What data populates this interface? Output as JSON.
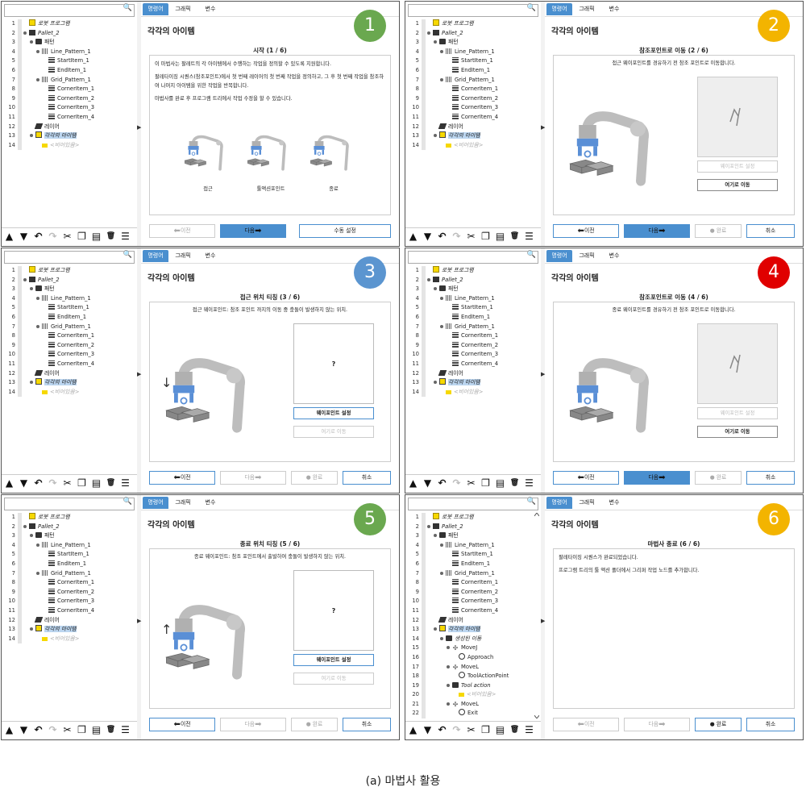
{
  "tree": {
    "base": [
      {
        "n": "1",
        "label": "로봇 프로그램",
        "icon": "prog",
        "indent": 0,
        "italic": true,
        "pin": false
      },
      {
        "n": "2",
        "label": "Pallet_2",
        "icon": "pal",
        "indent": 0,
        "italic": true,
        "pin": true
      },
      {
        "n": "3",
        "label": "패턴",
        "icon": "fold",
        "indent": 1,
        "italic": false,
        "pin": true
      },
      {
        "n": "4",
        "label": "Line_Pattern_1",
        "icon": "grid",
        "indent": 2,
        "italic": false,
        "pin": true
      },
      {
        "n": "5",
        "label": "StartItem_1",
        "icon": "item",
        "indent": 3,
        "italic": false,
        "pin": false
      },
      {
        "n": "6",
        "label": "EndItem_1",
        "icon": "item",
        "indent": 3,
        "italic": false,
        "pin": false
      },
      {
        "n": "7",
        "label": "Grid_Pattern_1",
        "icon": "grid",
        "indent": 2,
        "italic": false,
        "pin": true
      },
      {
        "n": "8",
        "label": "CornerItem_1",
        "icon": "item",
        "indent": 3,
        "italic": false,
        "pin": false
      },
      {
        "n": "9",
        "label": "CornerItem_2",
        "icon": "item",
        "indent": 3,
        "italic": false,
        "pin": false
      },
      {
        "n": "10",
        "label": "CornerItem_3",
        "icon": "item",
        "indent": 3,
        "italic": false,
        "pin": false
      },
      {
        "n": "11",
        "label": "CornerItem_4",
        "icon": "item",
        "indent": 3,
        "italic": false,
        "pin": false
      },
      {
        "n": "12",
        "label": "레이어",
        "icon": "layer",
        "indent": 1,
        "italic": false,
        "pin": false
      },
      {
        "n": "13",
        "label": "각각의 아이템",
        "icon": "each",
        "indent": 1,
        "italic": true,
        "pin": true,
        "sel": true
      },
      {
        "n": "14",
        "label": "<비어있음>",
        "icon": "ph",
        "indent": 2,
        "italic": true,
        "pin": false,
        "gray": true
      }
    ],
    "final_tail": [
      {
        "n": "14",
        "label": "생성된 이동",
        "icon": "fold",
        "indent": 2,
        "italic": true,
        "pin": true
      },
      {
        "n": "15",
        "label": "MoveJ",
        "icon": "mv",
        "indent": 3,
        "italic": false,
        "pin": true
      },
      {
        "n": "16",
        "label": "Approach",
        "icon": "ring",
        "indent": 4,
        "italic": false,
        "pin": false
      },
      {
        "n": "17",
        "label": "MoveL",
        "icon": "mv",
        "indent": 3,
        "italic": false,
        "pin": true
      },
      {
        "n": "18",
        "label": "ToolActionPoint",
        "icon": "ring",
        "indent": 4,
        "italic": false,
        "pin": false
      },
      {
        "n": "19",
        "label": "Tool action",
        "icon": "fold",
        "indent": 3,
        "italic": true,
        "pin": true
      },
      {
        "n": "20",
        "label": "<비어있음>",
        "icon": "ph",
        "indent": 4,
        "italic": true,
        "pin": false,
        "gray": true
      },
      {
        "n": "21",
        "label": "MoveL",
        "icon": "mv",
        "indent": 3,
        "italic": false,
        "pin": true
      },
      {
        "n": "22",
        "label": "Exit",
        "icon": "ring",
        "indent": 4,
        "italic": false,
        "pin": false
      }
    ]
  },
  "tabs": [
    "명령어",
    "그래픽",
    "변수"
  ],
  "page_title": "각각의 아이템",
  "buttons": {
    "prev": "이전",
    "next": "다음",
    "finish": "완료",
    "cancel": "취소",
    "manual": "수동 설정",
    "set_waypoint": "웨이포인트 설정",
    "move_here": "여기로 이동"
  },
  "panels": [
    {
      "badge": "1",
      "badge_color": "#6aa84f",
      "step": "시작 (1 / 6)",
      "texts": [
        "이 마법사는 팔레트의 각 아이템에서 수행하는 작업을 정의할 수 있도록 지원합니다.",
        "팔레타이징 시퀀스(참조포인트)에서 첫 번째 레이어의 첫 번째 작업을 정의하고, 그 후 첫 번째 작업을 참조하여 나머지 아이템을 위한 작업을 반복합니다.",
        "마법사를 완료 후 프로그램 트리에서 작업 수정을 할 수 있습니다."
      ],
      "robot_labels": [
        "접근",
        "툴액션포인트",
        "종료"
      ]
    },
    {
      "badge": "2",
      "badge_color": "#f3b400",
      "step": "참조포인트로 이동 (2 / 6)",
      "sub": "접근 웨이포인트를 경유하기 전 참조 포인트로 이동합니다."
    },
    {
      "badge": "3",
      "badge_color": "#5b95d0",
      "step": "접근 위치 티칭 (3 / 6)",
      "sub": "접근 웨이포인트: 참조 포인트 까지의 이동 중 충돌이 발생하지 않는 위치.",
      "q": "?"
    },
    {
      "badge": "4",
      "badge_color": "#e00000",
      "step": "참조포인트로 이동 (4 / 6)",
      "sub": "종료 웨이포인트를 경유하기 전 참조 포인트로 이동합니다."
    },
    {
      "badge": "5",
      "badge_color": "#6aa84f",
      "step": "종료 위치 티칭 (5 / 6)",
      "sub": "종료 웨이포인트: 참조 포인트에서 출발하여 충돌이 발생하지 않는 위치.",
      "q": "?"
    },
    {
      "badge": "6",
      "badge_color": "#f3b400",
      "step": "마법사 종료 (6 / 6)",
      "texts": [
        "팔레타이징 시퀀스가 완료되었습니다.",
        "프로그램 트리의 툴 액션 폴더에서 그리퍼 작업 노드를 추가합니다."
      ]
    }
  ],
  "caption": "(a) 마법사 활용"
}
